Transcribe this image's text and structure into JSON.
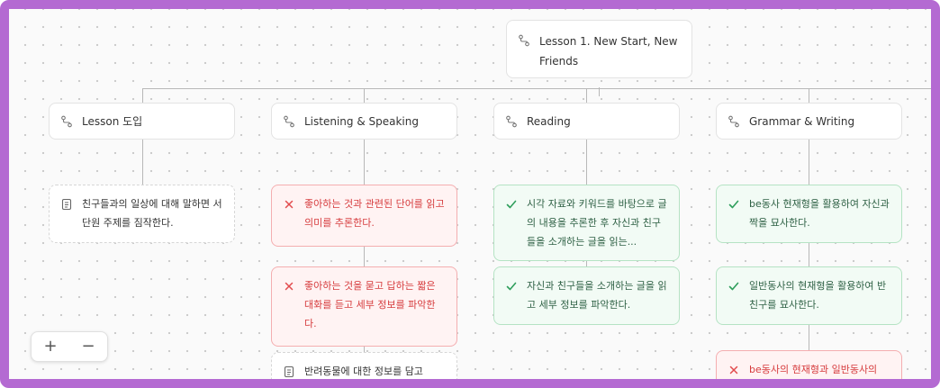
{
  "root": {
    "label": "Lesson 1. New Start, New Friends",
    "line1": "Lesson 1. New Start, New",
    "line2": "Friends",
    "icon": "route-icon"
  },
  "lessons": [
    {
      "label": "Lesson 도입",
      "icon": "route-icon"
    },
    {
      "label": "Listening & Speaking",
      "icon": "route-icon"
    },
    {
      "label": "Reading",
      "icon": "route-icon"
    },
    {
      "label": "Grammar & Writing",
      "icon": "route-icon"
    }
  ],
  "cards": {
    "intro": [
      {
        "status": "neutral",
        "icon": "document-icon",
        "text": "친구들과의 일상에 대해 말하면 서 단원 주제를 짐작한다."
      }
    ],
    "listening": [
      {
        "status": "fail",
        "icon": "x-icon",
        "text": "좋아하는 것과 관련된 단어를 읽고 의미를 추론한다."
      },
      {
        "status": "fail",
        "icon": "x-icon",
        "text": "좋아하는 것을 묻고 답하는 짧은 대화를 듣고 세부 정보를 파악한다."
      },
      {
        "status": "neutral",
        "icon": "document-icon",
        "text": "반려동물에 대한 정보를 담고"
      }
    ],
    "reading": [
      {
        "status": "ok",
        "icon": "check-icon",
        "text": "시각 자료와 키워드를 바탕으로 글의 내용을 추론한 후 자신과 친구들을 소개하는 글을 읽는..."
      },
      {
        "status": "ok",
        "icon": "check-icon",
        "text": "자신과 친구들을 소개하는 글을 읽고 세부 정보를 파악한다."
      }
    ],
    "grammar": [
      {
        "status": "ok",
        "icon": "check-icon",
        "text": "be동사 현재형을 활용하여 자신과 짝을 묘사한다."
      },
      {
        "status": "ok",
        "icon": "check-icon",
        "text": "일반동사의 현재형을 활용하여 반 친구를 묘사한다."
      },
      {
        "status": "fail",
        "icon": "x-icon",
        "text": "be동사의 현재형과 일반동사의"
      }
    ]
  },
  "zoom": {
    "in": "+",
    "out": "−"
  },
  "colors": {
    "border": "#b46ad2",
    "fail": "#d63b3d",
    "ok": "#2f9e5c"
  }
}
